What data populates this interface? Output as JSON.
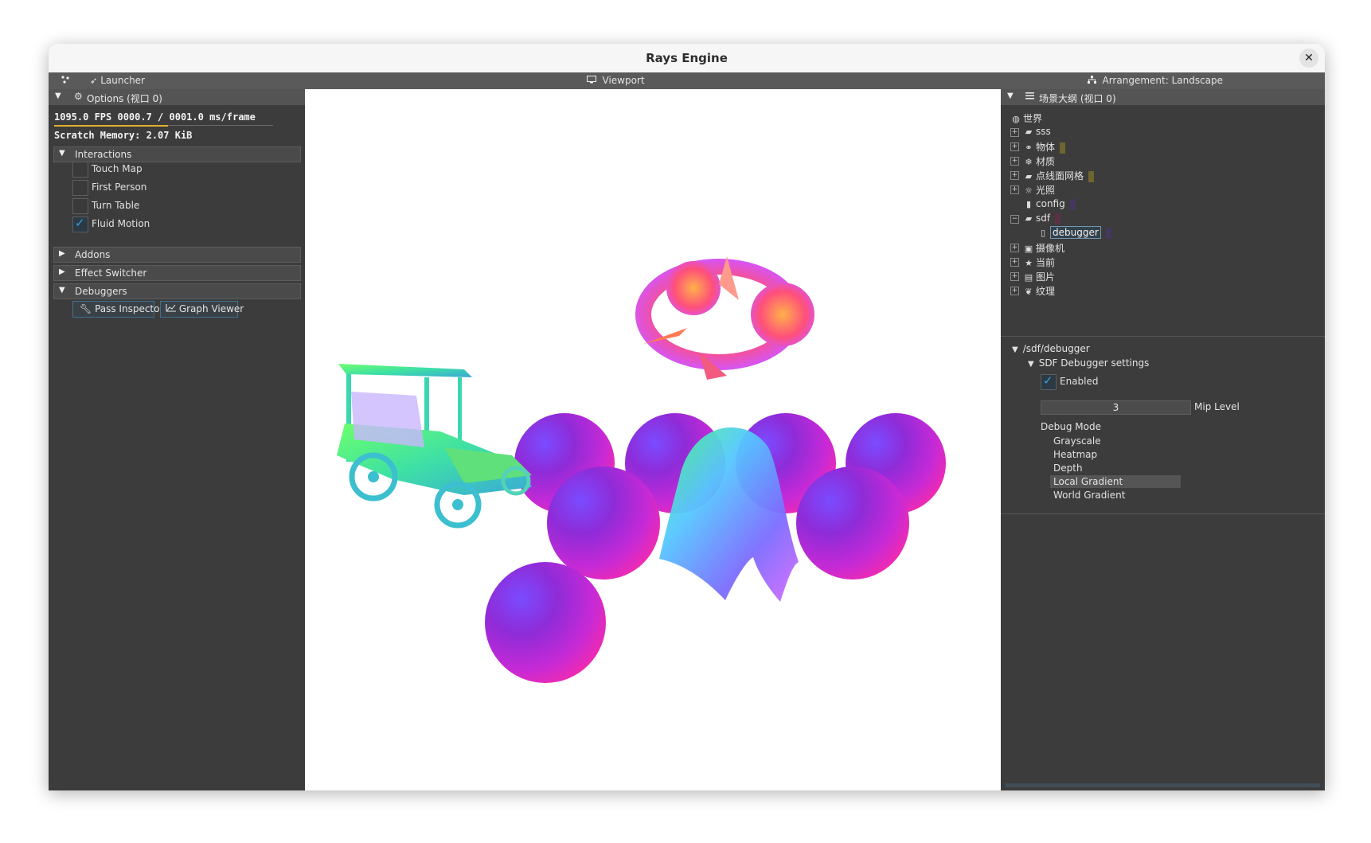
{
  "window": {
    "title": "Rays Engine",
    "close_glyph": "✕"
  },
  "menubar": {
    "launcher_label": "Launcher",
    "viewport_label": "Viewport",
    "arrangement_label": "Arrangement: Landscape"
  },
  "options_panel": {
    "title": "Options (视口 0)",
    "fps_line": "1095.0 FPS  0000.7 / 0001.0 ms/frame",
    "scratch_line": "Scratch Memory: 2.07 KiB",
    "interactions_title": "Interactions",
    "checkboxes": [
      {
        "label": "Touch Map",
        "checked": false
      },
      {
        "label": "First Person",
        "checked": false
      },
      {
        "label": "Turn Table",
        "checked": false
      },
      {
        "label": "Fluid Motion",
        "checked": true
      }
    ],
    "addons_title": "Addons",
    "effect_switcher_title": "Effect Switcher",
    "debuggers_title": "Debuggers",
    "pass_inspector_label": "Pass Inspector",
    "graph_viewer_label": "Graph Viewer"
  },
  "outline_panel": {
    "title": "场景大纲 (视口 0)",
    "root": "世界",
    "items": [
      {
        "label": "sss",
        "icon": "folder-icon",
        "swatch": ""
      },
      {
        "label": "物体",
        "icon": "shapes-icon",
        "swatch": "#6e6530"
      },
      {
        "label": "材质",
        "icon": "snowflake-icon",
        "swatch": ""
      },
      {
        "label": "点线面网格",
        "icon": "folder-icon",
        "swatch": "#6e6530"
      },
      {
        "label": "光照",
        "icon": "light-icon",
        "swatch": ""
      },
      {
        "label": "config",
        "icon": "file-icon",
        "swatch": "#44385e"
      },
      {
        "label": "sdf",
        "icon": "folder-icon",
        "swatch": "#5e3046"
      },
      {
        "label": "debugger",
        "icon": "file-icon",
        "swatch": "#44385e"
      },
      {
        "label": "摄像机",
        "icon": "camera-icon",
        "swatch": ""
      },
      {
        "label": "当前",
        "icon": "star-icon",
        "swatch": ""
      },
      {
        "label": "图片",
        "icon": "film-icon",
        "swatch": ""
      },
      {
        "label": "纹理",
        "icon": "leaf-icon",
        "swatch": ""
      }
    ]
  },
  "inspector": {
    "path": "/sdf/debugger",
    "settings_title": "SDF Debugger settings",
    "enabled_label": "Enabled",
    "enabled": true,
    "mip_level_value": "3",
    "mip_level_label": "Mip Level",
    "debug_mode_label": "Debug Mode",
    "debug_modes": [
      "Grayscale",
      "Heatmap",
      "Depth",
      "Local Gradient",
      "World Gradient"
    ],
    "selected_mode": "Local Gradient"
  },
  "colors": {
    "panel_bg": "#3c3c3c",
    "menubar_bg": "#5a5a5a",
    "accent_check": "#33a2e4",
    "sphere_gradient": [
      "#8a2bd8",
      "#c42adf",
      "#ff2bb0"
    ]
  }
}
